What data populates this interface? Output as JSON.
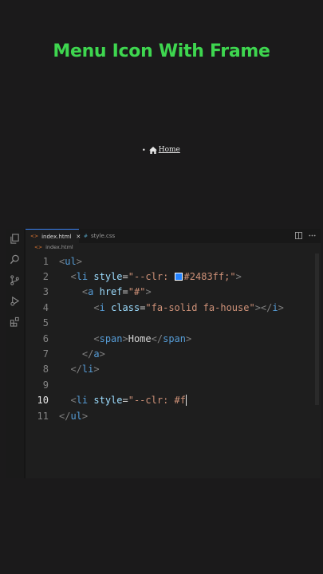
{
  "title": "Menu Icon With Frame",
  "preview": {
    "bullet": "•",
    "link_text": "Home"
  },
  "tabs": [
    {
      "label": "index.html",
      "icon": "html-file-icon",
      "close": "✕"
    },
    {
      "label": "style.css",
      "icon": "css-file-icon"
    }
  ],
  "breadcrumb": {
    "file": "index.html"
  },
  "colors": {
    "title": "#3ed64f",
    "swatch": "#2483ff",
    "accent": "#3b82f6"
  },
  "code": {
    "line_numbers": [
      "1",
      "2",
      "3",
      "4",
      "5",
      "6",
      "7",
      "8",
      "9",
      "10",
      "11"
    ],
    "current_line": "10",
    "l1": {
      "open": "<",
      "tag": "ul",
      "close": ">"
    },
    "l2": {
      "open": "<",
      "tag": "li",
      "attr": "style",
      "eq": "=",
      "q1": "\"",
      "s1": "--clr: ",
      "s2": "#2483ff;",
      "q2": "\"",
      "close": ">"
    },
    "l3": {
      "open": "<",
      "tag": "a",
      "attr": "href",
      "eq": "=",
      "str": "\"#\"",
      "close": ">"
    },
    "l4": {
      "open": "<",
      "tag": "i",
      "attr": "class",
      "eq": "=",
      "str": "\"fa-solid fa-house\"",
      "mid": "></",
      "tag2": "i",
      "close": ">"
    },
    "l6": {
      "open": "<",
      "tag": "span",
      "mid1": ">",
      "text": "Home",
      "mid2": "</",
      "tag2": "span",
      "close": ">"
    },
    "l7": {
      "open": "</",
      "tag": "a",
      "close": ">"
    },
    "l8": {
      "open": "</",
      "tag": "li",
      "close": ">"
    },
    "l10": {
      "open": "<",
      "tag": "li",
      "attr": "style",
      "eq": "=",
      "str": "\"--clr: #f"
    },
    "l11": {
      "open": "</",
      "tag": "ul",
      "close": ">"
    }
  }
}
